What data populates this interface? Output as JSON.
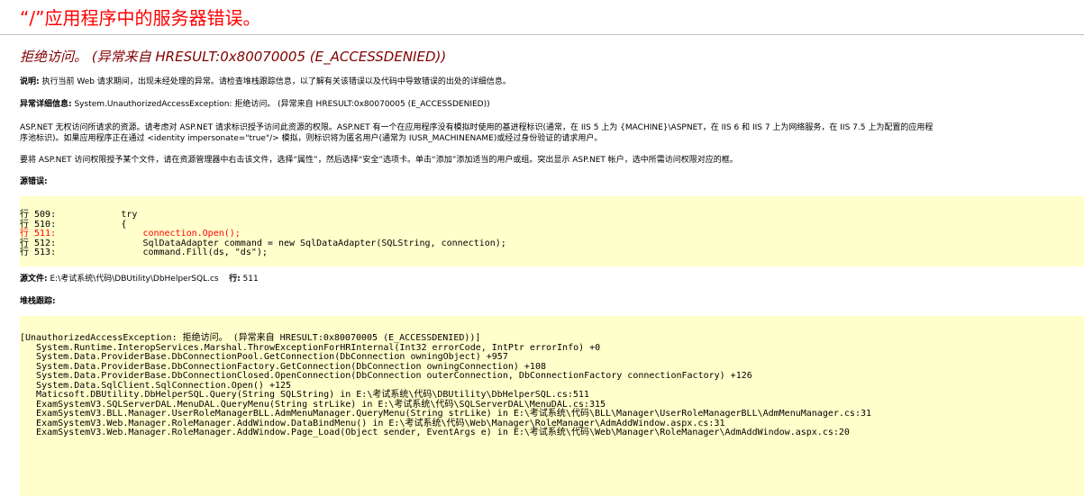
{
  "title": "“/”应用程序中的服务器错误。",
  "subtitle": "拒绝访问。 (异常来自 HRESULT:0x80070005 (E_ACCESSDENIED))",
  "description": {
    "label": "说明:",
    "text": " 执行当前 Web 请求期间，出现未经处理的异常。请检查堆栈跟踪信息，以了解有关该错误以及代码中导致错误的出处的详细信息。"
  },
  "exception_details": {
    "label": "异常详细信息:",
    "text": " System.UnauthorizedAccessException: 拒绝访问。 (异常来自 HRESULT:0x80070005 (E_ACCESSDENIED))"
  },
  "info": {
    "line1": "ASP.NET 无权访问所请求的资源。请考虑对 ASP.NET 请求标识授予访问此资源的权限。ASP.NET 有一个在应用程序没有模拟时使用的基进程标识(通常，在 IIS 5 上为 {MACHINE}\\ASPNET，在 IIS 6 和 IIS 7 上为网络服务，在 IIS 7.5 上为配置的应用程",
    "line2": "序池标识)。如果应用程序正在通过 <identity impersonate=\"true\"/> 模拟，则标识将为匿名用户(通常为 IUSR_MACHINENAME)或经过身份验证的请求用户。"
  },
  "grant": "要将 ASP.NET 访问权限授予某个文件，请在资源管理器中右击该文件，选择“属性”，然后选择“安全”选项卡。单击“添加”添加适当的用户或组。突出显示 ASP.NET 帐户，选中所需访问权限对应的框。",
  "source_error_label": "源错误:",
  "source_lines": [
    {
      "num": "行 509:",
      "code": "            try",
      "error": false
    },
    {
      "num": "行 510:",
      "code": "            {",
      "error": false
    },
    {
      "num": "行 511:",
      "code": "                connection.Open();",
      "error": true
    },
    {
      "num": "行 512:",
      "code": "                SqlDataAdapter command = new SqlDataAdapter(SQLString, connection);",
      "error": false
    },
    {
      "num": "行 513:",
      "code": "                command.Fill(ds, \"ds\");",
      "error": false
    }
  ],
  "source_file": {
    "label": "源文件:",
    "path": " E:\\考试系统\\代码\\DBUtility\\DbHelperSQL.cs",
    "line_label": "行:",
    "line_value": " 511"
  },
  "stack_trace_label": "堆栈跟踪:",
  "stack_lines": [
    "[UnauthorizedAccessException: 拒绝访问。 (异常来自 HRESULT:0x80070005 (E_ACCESSDENIED))]",
    "   System.Runtime.InteropServices.Marshal.ThrowExceptionForHRInternal(Int32 errorCode, IntPtr errorInfo) +0",
    "   System.Data.ProviderBase.DbConnectionPool.GetConnection(DbConnection owningObject) +957",
    "   System.Data.ProviderBase.DbConnectionFactory.GetConnection(DbConnection owningConnection) +108",
    "   System.Data.ProviderBase.DbConnectionClosed.OpenConnection(DbConnection outerConnection, DbConnectionFactory connectionFactory) +126",
    "   System.Data.SqlClient.SqlConnection.Open() +125",
    "   Maticsoft.DBUtility.DbHelperSQL.Query(String SQLString) in E:\\考试系统\\代码\\DBUtility\\DbHelperSQL.cs:511",
    "   ExamSystemV3.SQLServerDAL.MenuDAL.QueryMenu(String strLike) in E:\\考试系统\\代码\\SQLServerDAL\\MenuDAL.cs:315",
    "   ExamSystemV3.BLL.Manager.UserRoleManagerBLL.AdmMenuManager.QueryMenu(String strLike) in E:\\考试系统\\代码\\BLL\\Manager\\UserRoleManagerBLL\\AdmMenuManager.cs:31",
    "   ExamSystemV3.Web.Manager.RoleManager.AddWindow.DataBindMenu() in E:\\考试系统\\代码\\Web\\Manager\\RoleManager\\AdmAddWindow.aspx.cs:31",
    "   ExamSystemV3.Web.Manager.RoleManager.AddWindow.Page_Load(Object sender, EventArgs e) in E:\\考试系统\\代码\\Web\\Manager\\RoleManager\\AdmAddWindow.aspx.cs:20"
  ],
  "colors": {
    "title": "#ff0000",
    "subtitle": "#800000",
    "code_background": "#ffffcc",
    "error_line": "#ff0000"
  }
}
